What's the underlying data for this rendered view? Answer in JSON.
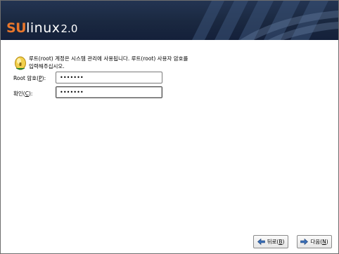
{
  "brand": {
    "su": "SU",
    "linux": "linux",
    "version": "2.0"
  },
  "description": "루트(root) 계정은 시스템 관리에 사용됩니다. 루트(root) 사용자 암호를 입력해주십시오.",
  "fields": {
    "root_password": {
      "label_pre": "Root 암호(",
      "mnemonic": "P",
      "label_post": "):",
      "value": "•••••••"
    },
    "confirm": {
      "label_pre": "확인(",
      "mnemonic": "C",
      "label_post": "):",
      "value": "•••••••"
    }
  },
  "buttons": {
    "back": {
      "label_pre": "뒤로(",
      "mnemonic": "B",
      "label_post": ")"
    },
    "next": {
      "label_pre": "다음(",
      "mnemonic": "N",
      "label_post": ")"
    }
  },
  "colors": {
    "banner": "#1a2840",
    "brand_accent": "#e8762b",
    "icon_accent": "#2a8a2a"
  }
}
